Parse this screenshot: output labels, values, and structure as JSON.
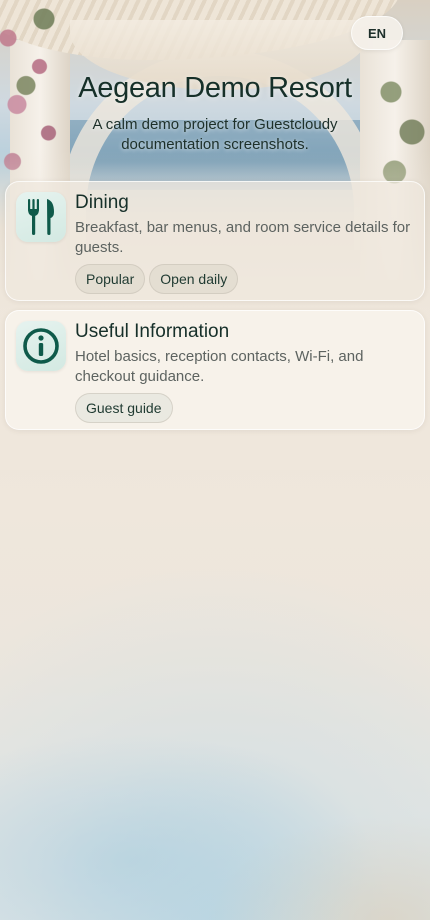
{
  "header": {
    "language_label": "EN",
    "title": "Aegean Demo Resort",
    "subtitle": "A calm demo project for Guestcloudy documentation screenshots."
  },
  "cards": [
    {
      "icon": "fork-knife-icon",
      "title": "Dining",
      "description": "Breakfast, bar menus, and room service details for guests.",
      "tags": [
        "Popular",
        "Open daily"
      ]
    },
    {
      "icon": "info-icon",
      "title": "Useful Information",
      "description": "Hotel basics, reception contacts, Wi-Fi, and checkout guidance.",
      "tags": [
        "Guest guide"
      ]
    }
  ],
  "colors": {
    "accent": "#0f5a4a",
    "text": "#17302a",
    "muted": "#5d6360"
  }
}
